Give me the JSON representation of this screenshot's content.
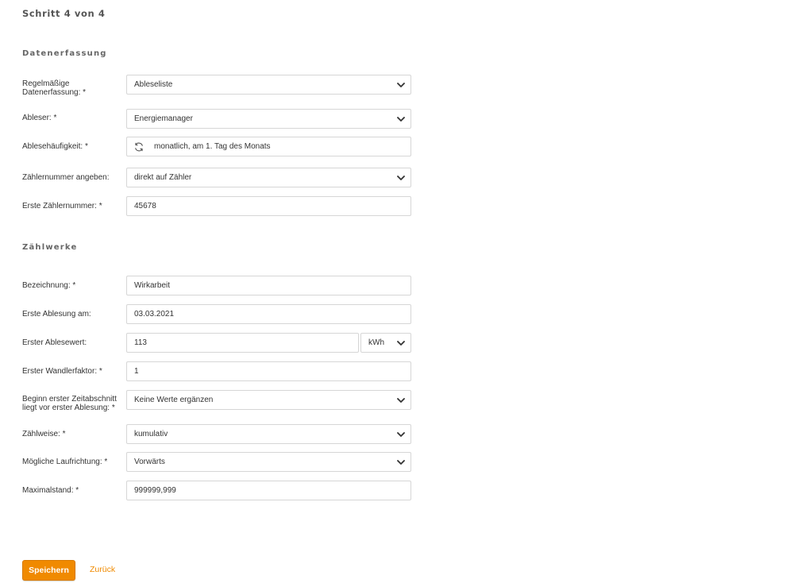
{
  "header": {
    "step": "Schritt 4 von 4"
  },
  "sections": {
    "data_capture": "Datenerfassung",
    "registers": "Zählwerke"
  },
  "data_capture": {
    "regular": {
      "label_line1": "Regelmäßige",
      "label_line2": "Datenerfassung: *",
      "value": "Ableseliste"
    },
    "reader": {
      "label": "Ableser: *",
      "value": "Energiemanager"
    },
    "frequency": {
      "label": "Ablesehäufigkeit: *",
      "value": "monatlich, am 1. Tag des Monats",
      "icon": "sync-icon"
    },
    "meter_number_source": {
      "label": "Zählernummer angeben:",
      "value": "direkt auf Zähler"
    },
    "first_meter_number": {
      "label": "Erste Zählernummer: *",
      "value": "45678"
    }
  },
  "registers": {
    "designation": {
      "label": "Bezeichnung: *",
      "value": "Wirkarbeit"
    },
    "first_reading_date": {
      "label": "Erste Ablesung am:",
      "value": "03.03.2021"
    },
    "first_reading_value": {
      "label": "Erster Ablesewert:",
      "value": "113",
      "unit": "kWh"
    },
    "first_transformer_factor": {
      "label": "Erster Wandlerfaktor: *",
      "value": "1"
    },
    "period_start": {
      "label_line1": "Beginn erster Zeitabschnitt",
      "label_line2": "liegt vor erster Ablesung: *",
      "value": "Keine Werte ergänzen"
    },
    "counting_mode": {
      "label": "Zählweise: *",
      "value": "kumulativ"
    },
    "direction": {
      "label": "Mögliche Laufrichtung: *",
      "value": "Vorwärts"
    },
    "max_value": {
      "label": "Maximalstand: *",
      "value": "999999,999"
    }
  },
  "actions": {
    "save": "Speichern",
    "back": "Zurück"
  },
  "colors": {
    "accent": "#f08a00",
    "border": "#d6d6d6",
    "text": "#333333"
  }
}
